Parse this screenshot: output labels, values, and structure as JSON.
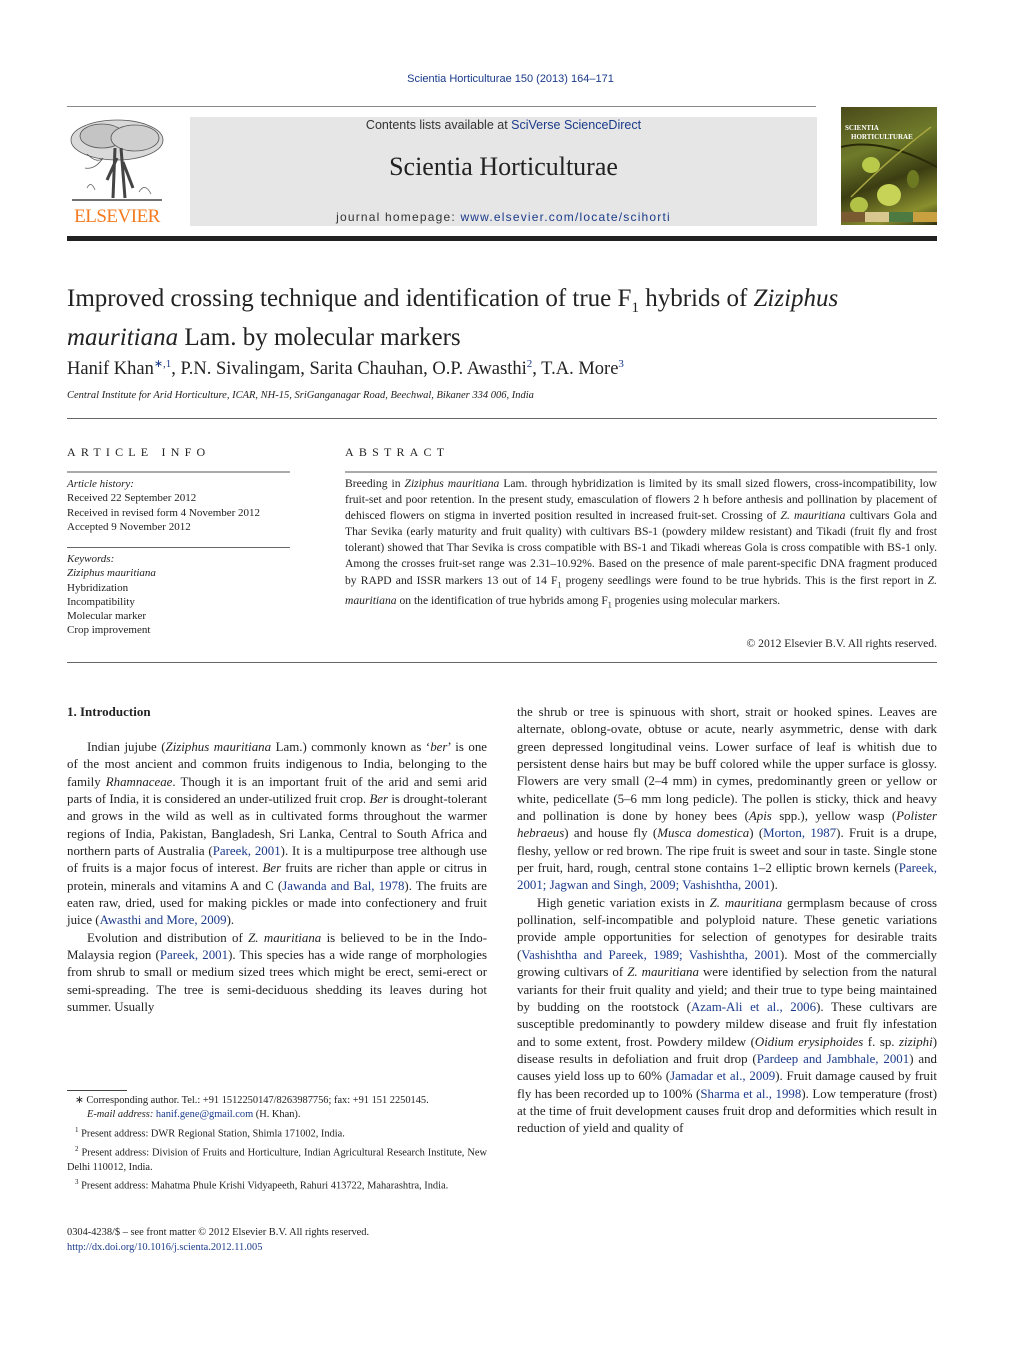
{
  "running_head": "Scientia Horticulturae 150 (2013) 164–171",
  "banner": {
    "contents_prefix": "Contents lists available at ",
    "contents_link": "SciVerse ScienceDirect",
    "journal_name": "Scientia Horticulturae",
    "homepage_prefix": "journal homepage: ",
    "homepage_link": "www.elsevier.com/locate/scihorti"
  },
  "publisher_logo": {
    "word": "ELSEVIER",
    "color": "#f47b20"
  },
  "cover": {
    "title_line1": "SCIENTIA",
    "title_line2": "HORTICULTURAE"
  },
  "article": {
    "title_part1": "Improved crossing technique and identification of true F",
    "title_sub": "1",
    "title_part2": " hybrids of ",
    "title_italic1": "Ziziphus",
    "title_italic2": "mauritiana",
    "title_part3": " Lam. by molecular markers",
    "authors": [
      {
        "name": "Hanif Khan",
        "sup": "∗,1"
      },
      {
        "name": ", P.N. Sivalingam, Sarita Chauhan, O.P. Awasthi",
        "sup": "2"
      },
      {
        "name": ", T.A. More",
        "sup": "3"
      }
    ],
    "affiliation": "Central Institute for Arid Horticulture, ICAR, NH-15, SriGanganagar Road, Beechwal, Bikaner 334 006, India"
  },
  "article_info": {
    "heading": "ARTICLE INFO",
    "history_label": "Article history:",
    "history": [
      "Received 22 September 2012",
      "Received in revised form 4 November 2012",
      "Accepted 9 November 2012"
    ],
    "keywords_label": "Keywords:",
    "keywords": [
      "Ziziphus mauritiana",
      "Hybridization",
      "Incompatibility",
      "Molecular marker",
      "Crop improvement"
    ]
  },
  "abstract": {
    "heading": "ABSTRACT",
    "p1a": "Breeding in ",
    "p1i": "Ziziphus mauritiana",
    "p1b": " Lam. through hybridization is limited by its small sized flowers, cross-incompatibility, low fruit-set and poor retention. In the present study, emasculation of flowers 2 h before anthesis and pollination by placement of dehisced flowers on stigma in inverted position resulted in increased fruit-set. Crossing of ",
    "p1i2": "Z. mauritiana",
    "p1c": " cultivars Gola and Thar Sevika (early maturity and fruit quality) with cultivars BS-1 (powdery mildew resistant) and Tikadi (fruit fly and frost tolerant) showed that Thar Sevika is cross compatible with BS-1 and Tikadi whereas Gola is cross compatible with BS-1 only. Among the crosses fruit-set range was 2.31–10.92%. Based on the presence of male parent-specific DNA fragment produced by RAPD and ISSR markers 13 out of 14 F",
    "p1sub": "1",
    "p1d": " progeny seedlings were found to be true hybrids. This is the first report in ",
    "p1i3": "Z. mauritiana",
    "p1e": " on the identification of true hybrids among F",
    "p1sub2": "1",
    "p1f": " progenies using molecular markers.",
    "copyright": "© 2012 Elsevier B.V. All rights reserved."
  },
  "intro": {
    "heading": "1.  Introduction",
    "left": {
      "p1_a": "Indian jujube (",
      "p1_i1": "Ziziphus mauritiana",
      "p1_b": " Lam.) commonly known as ‘",
      "p1_i2": "ber",
      "p1_c": "’ is one of the most ancient and common fruits indigenous to India, belonging to the family ",
      "p1_i3": "Rhamnaceae",
      "p1_d": ". Though it is an important fruit of the arid and semi arid parts of India, it is considered an under-utilized fruit crop. ",
      "p1_i4": "Ber",
      "p1_e": " is drought-tolerant and grows in the wild as well as in cultivated forms throughout the warmer regions of India, Pakistan, Bangladesh, Sri Lanka, Central to South Africa and northern parts of Australia (",
      "p1_l1": "Pareek, 2001",
      "p1_f": "). It is a multipurpose tree although use of fruits is a major focus of interest. ",
      "p1_i5": "Ber",
      "p1_g": " fruits are richer than apple or citrus in protein, minerals and vitamins A and C (",
      "p1_l2": "Jawanda and Bal, 1978",
      "p1_h": "). The fruits are eaten raw, dried, used for making pickles or made into confectionery and fruit juice (",
      "p1_l3": "Awasthi and More, 2009",
      "p1_j": ").",
      "p2_a": "Evolution and distribution of ",
      "p2_i1": "Z. mauritiana",
      "p2_b": " is believed to be in the Indo-Malaysia region (",
      "p2_l1": "Pareek, 2001",
      "p2_c": "). This species has a wide range of morphologies from shrub to small or medium sized trees which might be erect, semi-erect or semi-spreading. The tree is semi-deciduous shedding its leaves during hot summer. Usually"
    },
    "right": {
      "p1_a": "the shrub or tree is spinuous with short, strait or hooked spines. Leaves are alternate, oblong-ovate, obtuse or acute, nearly asymmetric, dense with dark green depressed longitudinal veins. Lower surface of leaf is whitish due to persistent dense hairs but may be buff colored while the upper surface is glossy. Flowers are very small (2–4 mm) in cymes, predominantly green or yellow or white, pedicellate (5–6 mm long pedicle). The pollen is sticky, thick and heavy and pollination is done by honey bees (",
      "p1_i1": "Apis",
      "p1_b": " spp.), yellow wasp (",
      "p1_i2": "Polister hebraeus",
      "p1_c": ") and house fly (",
      "p1_i3": "Musca domestica",
      "p1_d": ") (",
      "p1_l1": "Morton, 1987",
      "p1_e": "). Fruit is a drupe, fleshy, yellow or red brown. The ripe fruit is sweet and sour in taste. Single stone per fruit, hard, rough, central stone contains 1–2 elliptic brown kernels (",
      "p1_l2": "Pareek, 2001; Jagwan and Singh, 2009; Vashishtha, 2001",
      "p1_f": ").",
      "p2_a": "High genetic variation exists in ",
      "p2_i1": "Z. mauritiana",
      "p2_b": " germplasm because of cross pollination, self-incompatible and polyploid nature. These genetic variations provide ample opportunities for selection of genotypes for desirable traits (",
      "p2_l1": "Vashishtha and Pareek, 1989; Vashishtha, 2001",
      "p2_c": "). Most of the commercially growing cultivars of ",
      "p2_i2": "Z. mauritiana",
      "p2_d": " were identified by selection from the natural variants for their fruit quality and yield; and their true to type being maintained by budding on the rootstock (",
      "p2_l2": "Azam-Ali et al., 2006",
      "p2_e": "). These cultivars are susceptible predominantly to powdery mildew disease and fruit fly infestation and to some extent, frost. Powdery mildew (",
      "p2_i3": "Oidium erysiphoides",
      "p2_f": " f. sp. ",
      "p2_i4": "ziziphi",
      "p2_g": ") disease results in defoliation and fruit drop (",
      "p2_l3": "Pardeep and Jambhale, 2001",
      "p2_h": ") and causes yield loss up to 60% (",
      "p2_l4": "Jamadar et al., 2009",
      "p2_j": "). Fruit damage caused by fruit fly has been recorded up to 100% (",
      "p2_l5": "Sharma et al., 1998",
      "p2_k": "). Low temperature (frost) at the time of fruit development causes fruit drop and deformities which result in reduction of yield and quality of"
    }
  },
  "footnotes": {
    "corr_mark": "∗",
    "corr_text": " Corresponding author. Tel.: +91 1512250147/8263987756; fax: +91 151 2250145.",
    "email_label": "E-mail address: ",
    "email": "hanif.gene@gmail.com",
    "email_suffix": " (H. Khan).",
    "notes": [
      {
        "mark": "1",
        "text": " Present address: DWR Regional Station, Shimla 171002, India."
      },
      {
        "mark": "2",
        "text": " Present address: Division of Fruits and Horticulture, Indian Agricultural Research Institute, New Delhi 110012, India."
      },
      {
        "mark": "3",
        "text": " Present address: Mahatma Phule Krishi Vidyapeeth, Rahuri 413722, Maharashtra, India."
      }
    ]
  },
  "front_matter": {
    "issn_line": "0304-4238/$ – see front matter © 2012 Elsevier B.V. All rights reserved.",
    "doi": "http://dx.doi.org/10.1016/j.scienta.2012.11.005"
  },
  "colors": {
    "link": "#1a3a8a",
    "banner_bg": "#e6e6e6",
    "elsevier_orange": "#f47b20"
  }
}
